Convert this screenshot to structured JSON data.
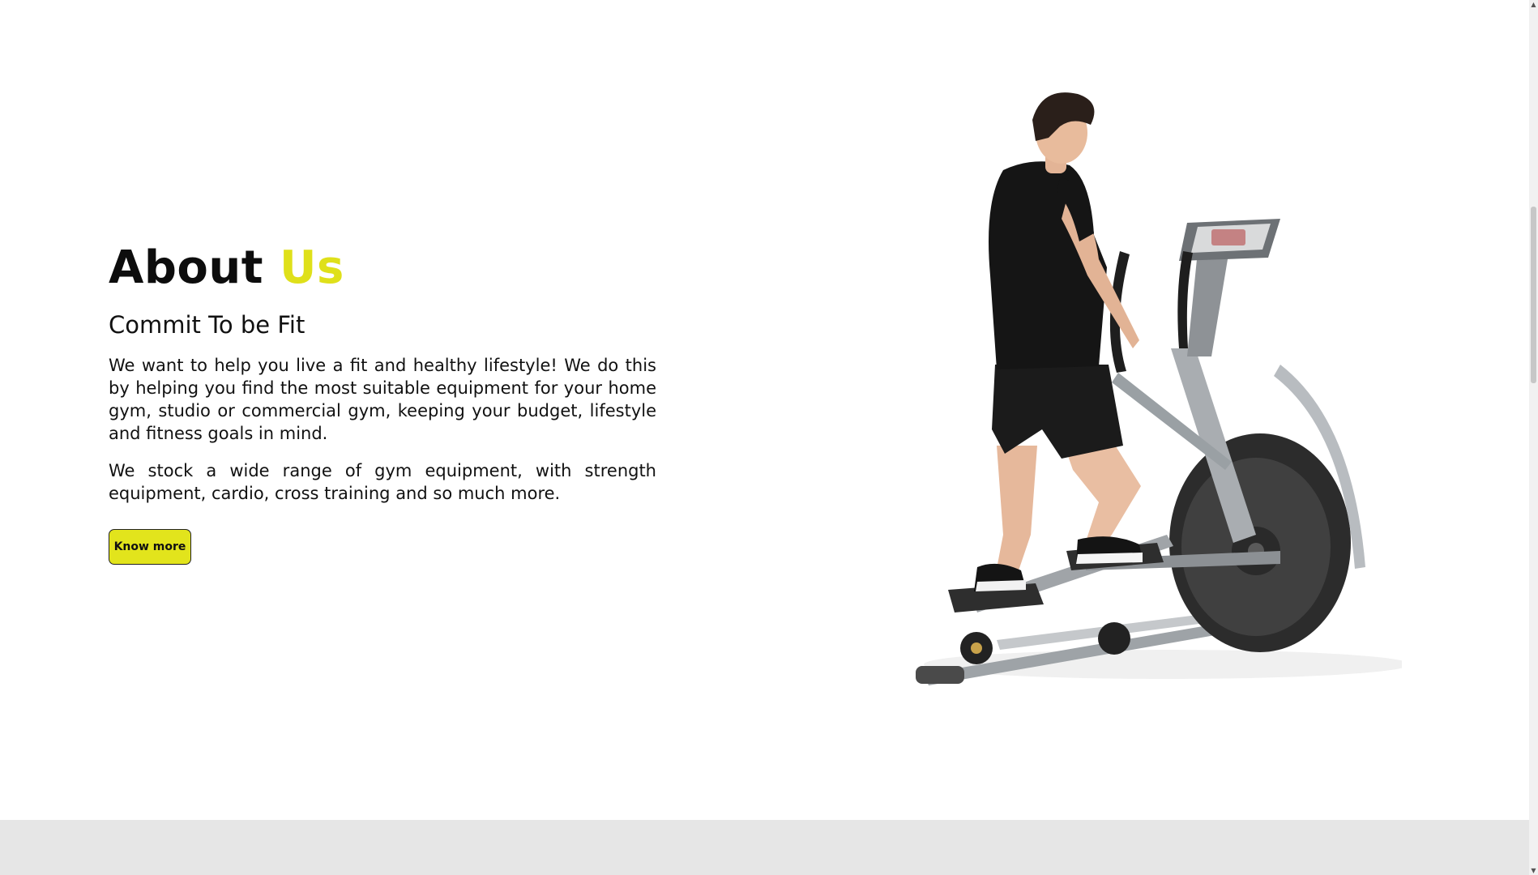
{
  "about": {
    "title_main": "About",
    "title_accent": "Us",
    "subtitle": "Commit To be Fit",
    "paragraphs": [
      "We want to help you live a fit and healthy lifestyle! We do this by helping you find the most suitable equipment for your home gym, studio or commercial gym, keeping your budget, lifestyle and fitness goals in mind.",
      "We stock a wide range of gym equipment, with strength equipment, cardio, cross training and so much more."
    ],
    "button_label": "Know more"
  },
  "image": {
    "subject": "man-on-elliptical-cross-trainer"
  },
  "colors": {
    "accent": "#dfe01a",
    "button_bg": "#e2e41c",
    "footer_band": "#e6e6e6",
    "text": "#111111"
  },
  "scrollbar": {
    "up_icon": "chevron-up-icon",
    "down_icon": "chevron-down-icon"
  }
}
